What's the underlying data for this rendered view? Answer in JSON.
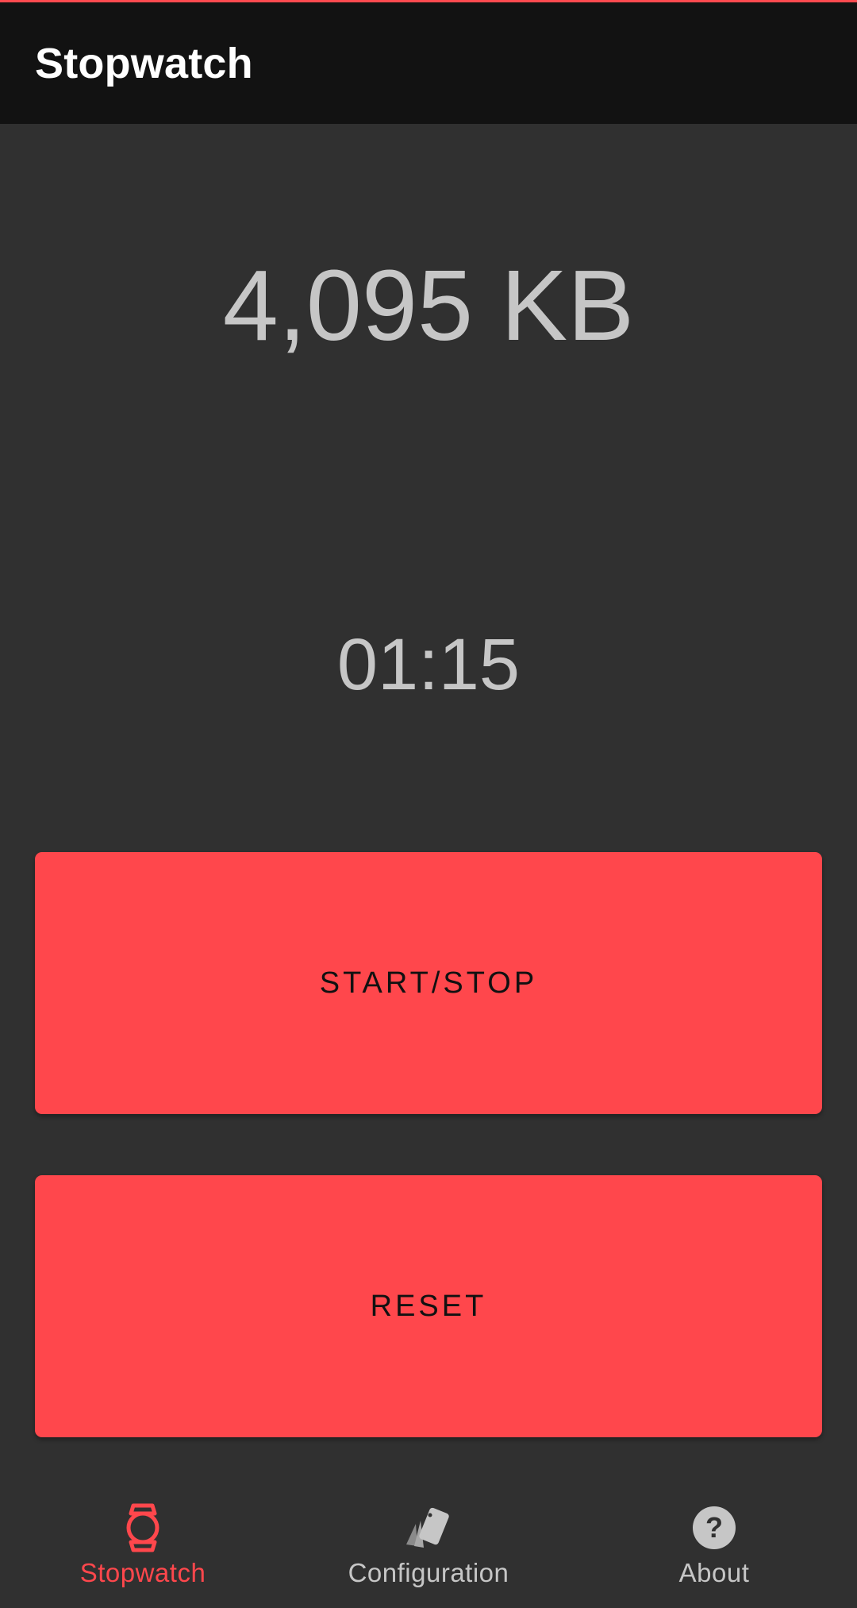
{
  "colors": {
    "accent": "#ff474c",
    "background": "#303030",
    "app_bar": "#121212",
    "readout_text": "#c6c6c6",
    "button_text": "#111111"
  },
  "app_bar": {
    "title": "Stopwatch"
  },
  "main": {
    "size_value": "4,095 KB",
    "elapsed_time": "01:15"
  },
  "buttons": {
    "start_stop_label": "START/STOP",
    "reset_label": "RESET"
  },
  "bottom_nav": {
    "items": [
      {
        "label": "Stopwatch",
        "icon": "watch-icon",
        "active": true
      },
      {
        "label": "Configuration",
        "icon": "cards-icon",
        "active": false
      },
      {
        "label": "About",
        "icon": "help-circle-icon",
        "active": false
      }
    ]
  }
}
